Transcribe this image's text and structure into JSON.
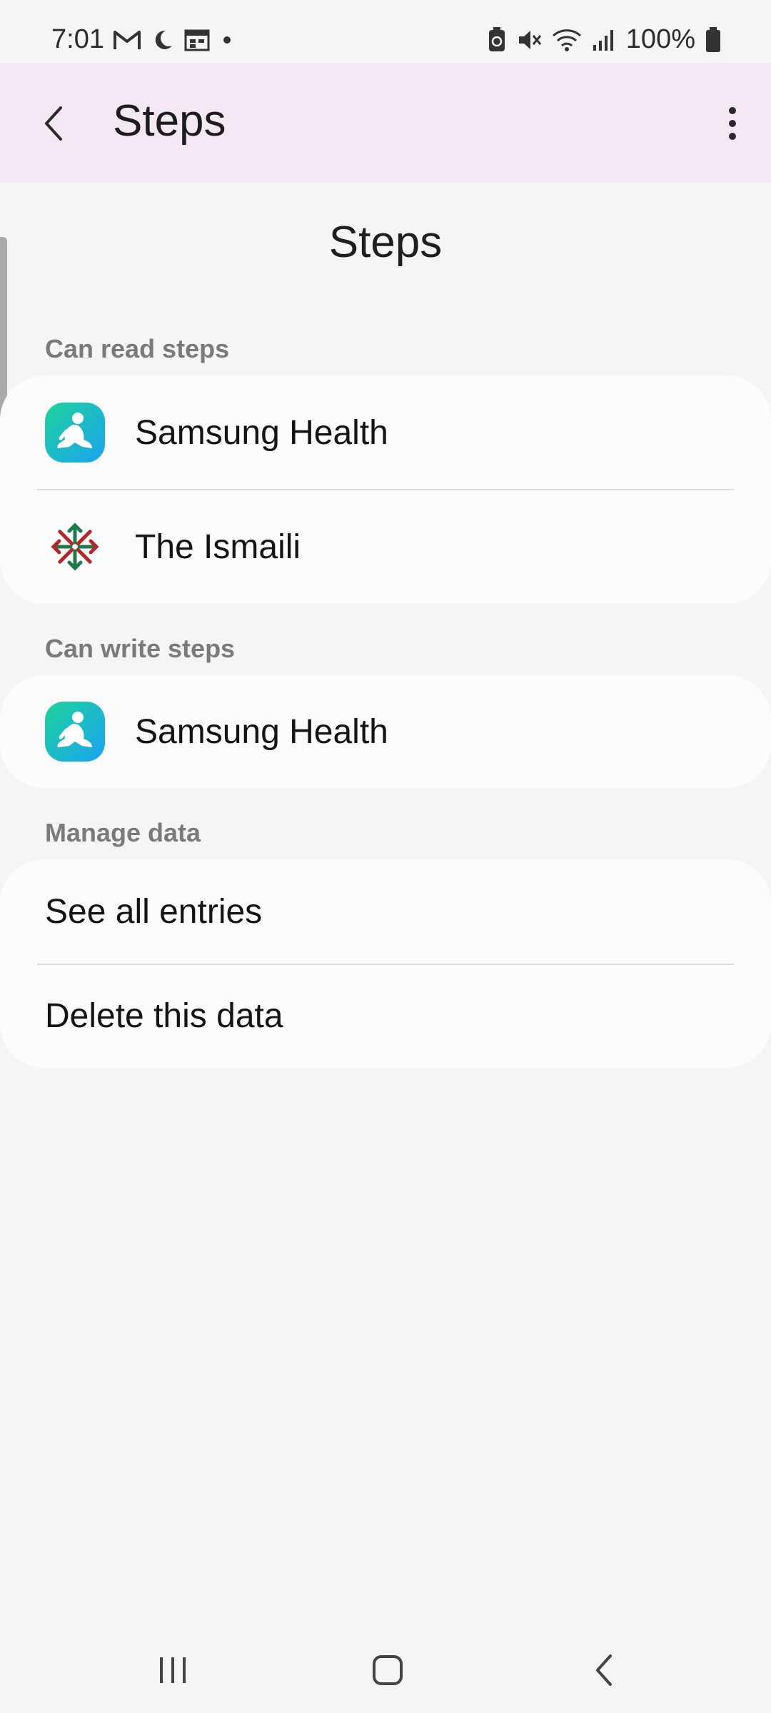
{
  "status_bar": {
    "time": "7:01",
    "battery": "100%",
    "left_icons": [
      "gmail-icon",
      "moon-icon",
      "calendar-icon",
      "dot-icon"
    ],
    "right_icons": [
      "battery-saver-icon",
      "mute-icon",
      "wifi-icon",
      "signal-icon",
      "battery-icon"
    ]
  },
  "app_bar": {
    "title": "Steps",
    "back_icon": "chevron-left-icon",
    "more_icon": "more-vertical-icon",
    "background": "#f3e8f4"
  },
  "page": {
    "heading": "Steps"
  },
  "sections": {
    "read": {
      "label": "Can read steps",
      "items": [
        {
          "label": "Samsung Health",
          "icon": "samsung-health-icon"
        },
        {
          "label": "The Ismaili",
          "icon": "ismaili-icon"
        }
      ]
    },
    "write": {
      "label": "Can write steps",
      "items": [
        {
          "label": "Samsung Health",
          "icon": "samsung-health-icon"
        }
      ]
    },
    "manage": {
      "label": "Manage data",
      "items": [
        {
          "label": "See all entries"
        },
        {
          "label": "Delete this data"
        }
      ]
    }
  },
  "nav_bar": {
    "items": [
      "recents-icon",
      "home-icon",
      "back-icon"
    ]
  },
  "colors": {
    "background": "#f5f5f5",
    "card": "#fcfcfc",
    "section_label": "#7a7a7a",
    "samsung_health_gradient": [
      "#1fd39a",
      "#1aa3f2"
    ]
  }
}
